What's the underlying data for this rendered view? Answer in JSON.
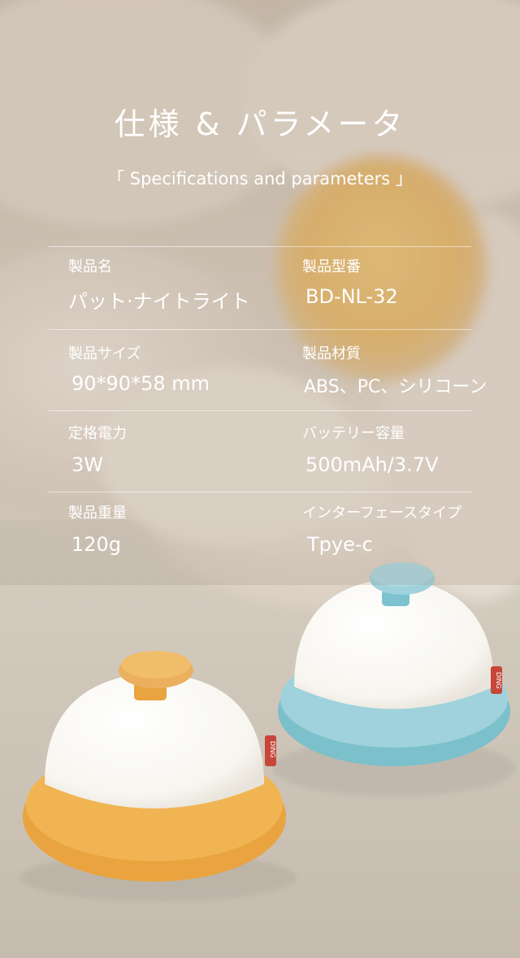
{
  "header": {
    "title": "仕様 & パラメータ",
    "subtitle": "「 Specifications and parameters 」"
  },
  "specs": [
    {
      "label": "製品名",
      "value": "パット·ナイトライト"
    },
    {
      "label": "製品型番",
      "value": "BD-NL-32"
    },
    {
      "label": "製品サイズ",
      "value": "90*90*58 mm"
    },
    {
      "label": "製品材質",
      "value": "ABS、PC、シリコーン"
    },
    {
      "label": "定格電力",
      "value": "3W"
    },
    {
      "label": "バッテリー容量",
      "value": "500mAh/3.7V"
    },
    {
      "label": "製品重量",
      "value": "120g"
    },
    {
      "label": "インターフェースタイプ",
      "value": "Tpye-c"
    }
  ],
  "product": {
    "brand_tag": "DING",
    "colors": {
      "orange": "#f1b452",
      "blue": "#9fd2dc",
      "dome": "#fbfbf8",
      "tag": "#c7463a"
    }
  }
}
